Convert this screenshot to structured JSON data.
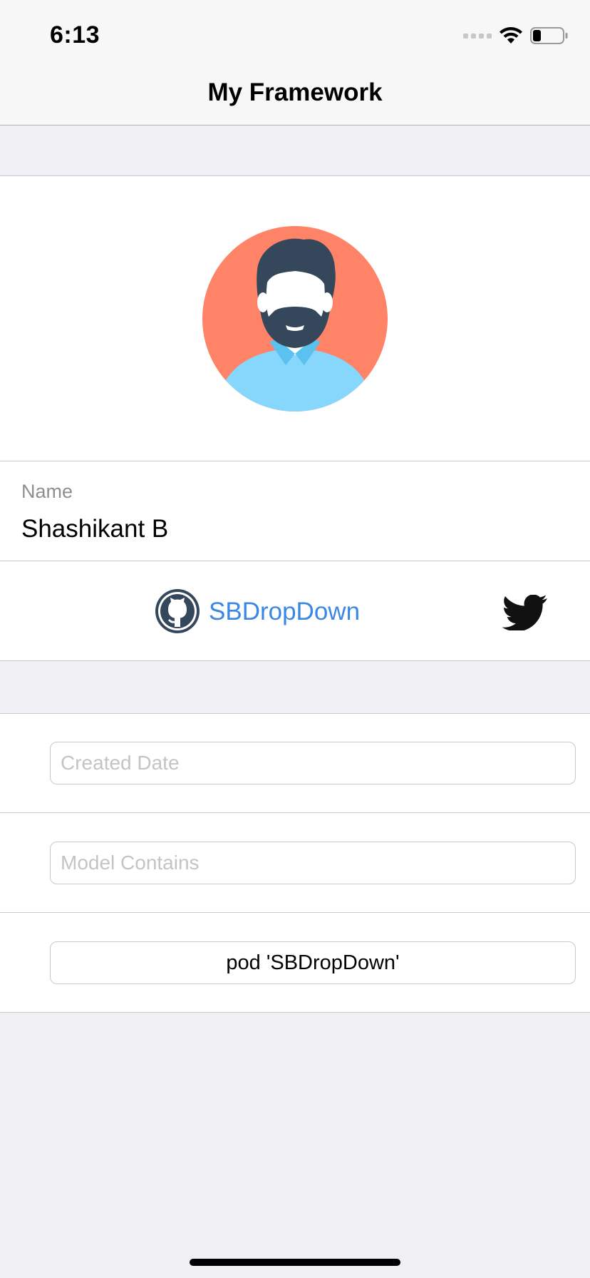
{
  "status_bar": {
    "time": "6:13",
    "icons": [
      "signal-dots-icon",
      "wifi-icon",
      "battery-icon"
    ]
  },
  "nav": {
    "title": "My Framework"
  },
  "profile": {
    "avatar": "avatar-icon",
    "name_label": "Name",
    "name_value": "Shashikant B"
  },
  "links": {
    "github_label": "SBDropDown",
    "github_icon": "github-icon",
    "twitter_icon": "twitter-icon"
  },
  "fields": {
    "created_date_placeholder": "Created Date",
    "created_date_value": "",
    "model_contains_placeholder": "Model Contains",
    "model_contains_value": ""
  },
  "pod_button_label": "pod 'SBDropDown'",
  "colors": {
    "link": "#3b87e5",
    "avatar_background": "#ff8367",
    "shirt": "#87d7fc",
    "hair": "#34475b"
  }
}
